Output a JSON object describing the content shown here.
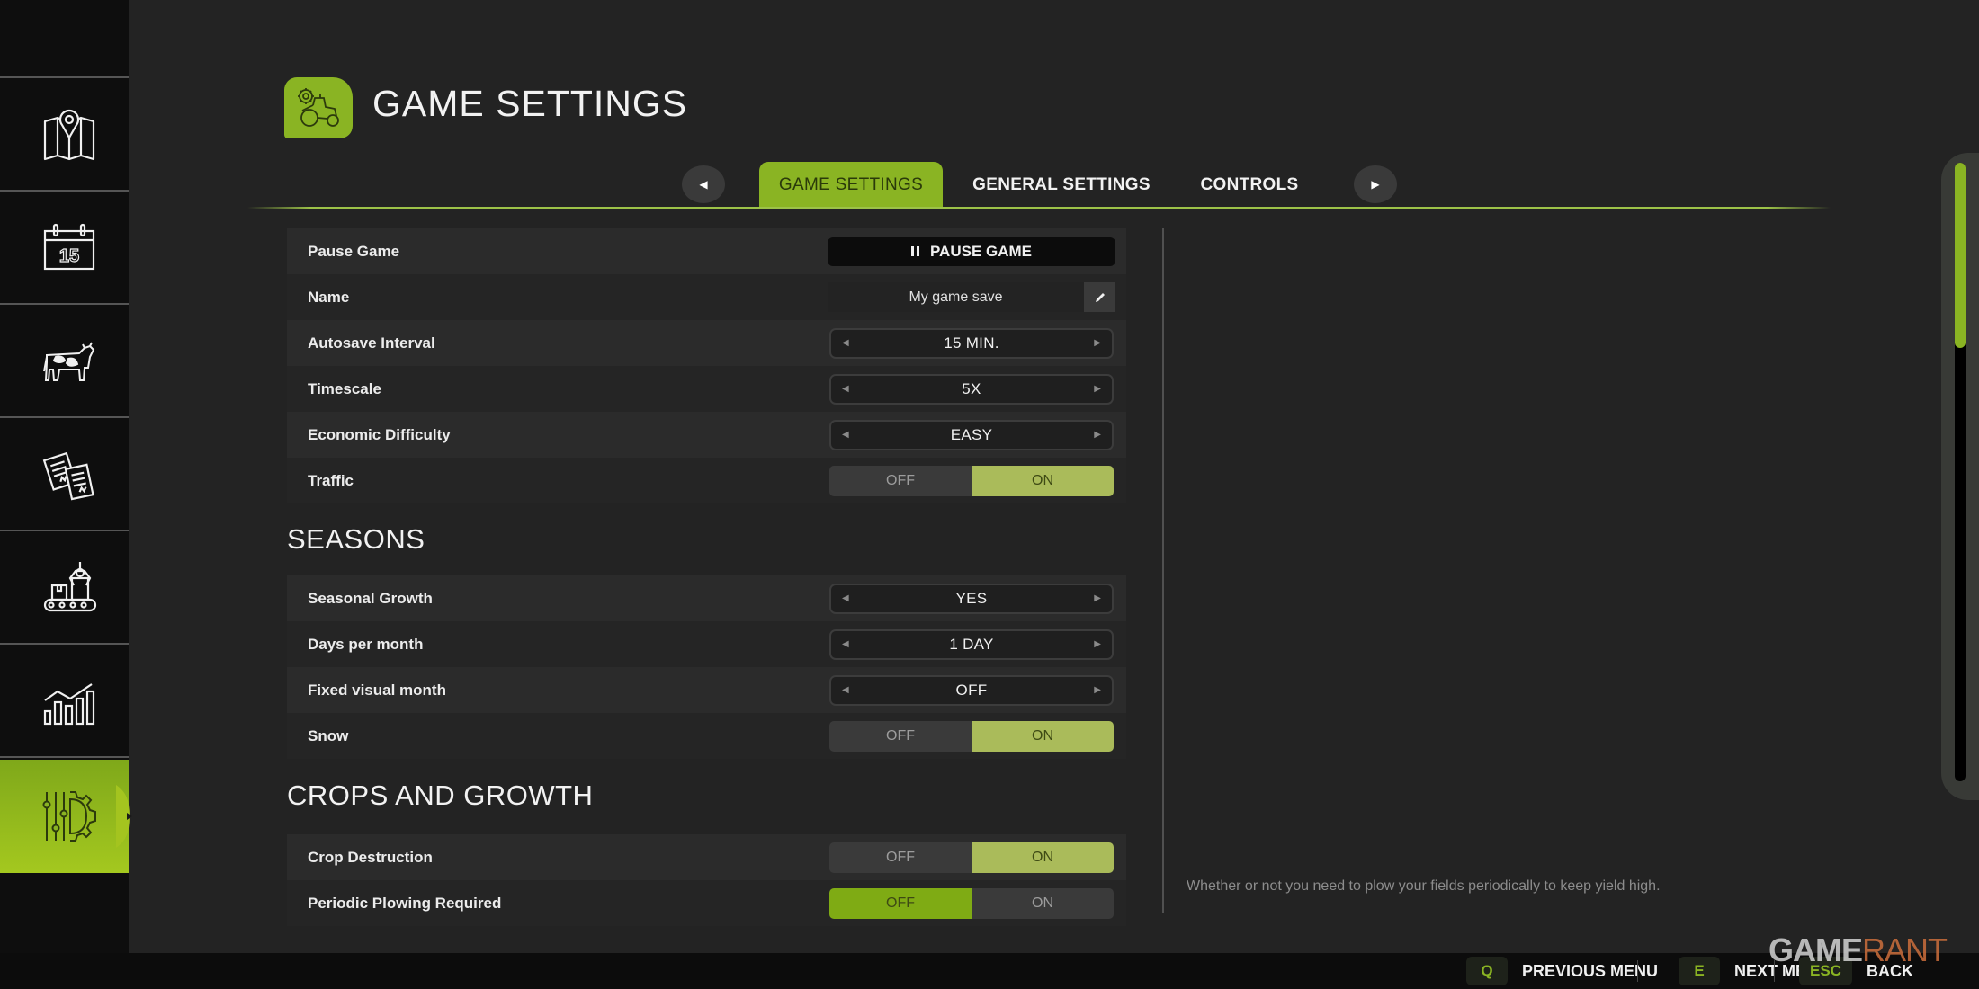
{
  "header": {
    "title": "GAME SETTINGS",
    "icon": "tractor-gear-icon"
  },
  "sidebar": {
    "items": [
      {
        "icon": "map-icon",
        "label": "Map"
      },
      {
        "icon": "calendar-icon",
        "label": "Calendar",
        "calendar_day": "15"
      },
      {
        "icon": "cow-icon",
        "label": "Animals"
      },
      {
        "icon": "contracts-icon",
        "label": "Contracts"
      },
      {
        "icon": "production-icon",
        "label": "Production"
      },
      {
        "icon": "statistics-icon",
        "label": "Statistics"
      },
      {
        "icon": "settings-icon",
        "label": "Settings",
        "active": true
      }
    ]
  },
  "tabs": {
    "prev_icon": "◀",
    "next_icon": "▶",
    "items": [
      {
        "label": "GAME SETTINGS",
        "active": true
      },
      {
        "label": "GENERAL SETTINGS",
        "active": false
      },
      {
        "label": "CONTROLS",
        "active": false
      }
    ]
  },
  "settings": {
    "general": [
      {
        "label": "Pause Game",
        "type": "button",
        "button_label": "PAUSE GAME"
      },
      {
        "label": "Name",
        "type": "text",
        "value": "My game save"
      },
      {
        "label": "Autosave Interval",
        "type": "selector",
        "value": "15 MIN."
      },
      {
        "label": "Timescale",
        "type": "selector",
        "value": "5X"
      },
      {
        "label": "Economic Difficulty",
        "type": "selector",
        "value": "EASY"
      },
      {
        "label": "Traffic",
        "type": "toggle",
        "off": "OFF",
        "on": "ON",
        "value": "ON"
      }
    ],
    "seasons": {
      "title": "SEASONS",
      "rows": [
        {
          "label": "Seasonal Growth",
          "type": "selector",
          "value": "YES"
        },
        {
          "label": "Days per month",
          "type": "selector",
          "value": "1 DAY"
        },
        {
          "label": "Fixed visual month",
          "type": "selector",
          "value": "OFF"
        },
        {
          "label": "Snow",
          "type": "toggle",
          "off": "OFF",
          "on": "ON",
          "value": "ON"
        }
      ]
    },
    "crops": {
      "title": "CROPS AND GROWTH",
      "rows": [
        {
          "label": "Crop Destruction",
          "type": "toggle",
          "off": "OFF",
          "on": "ON",
          "value": "ON"
        },
        {
          "label": "Periodic Plowing Required",
          "type": "toggle",
          "off": "OFF",
          "on": "ON",
          "value": "OFF"
        }
      ]
    }
  },
  "description": "Whether or not you need to plow your fields periodically to keep yield high.",
  "scrollbar": {
    "thumb_fraction": 0.3,
    "position_fraction": 0.0
  },
  "footer": {
    "hints": [
      {
        "key": "Q",
        "label": "PREVIOUS MENU"
      },
      {
        "key": "E",
        "label": "NEXT MENU"
      },
      {
        "key": "ESC",
        "label": "BACK"
      }
    ]
  },
  "watermark": {
    "part1": "GAME",
    "part2": "RANT"
  },
  "colors": {
    "accent": "#8ab423",
    "toggle_on": "#aabb5a",
    "background": "#232323",
    "sidebar": "#0e0e0e"
  }
}
